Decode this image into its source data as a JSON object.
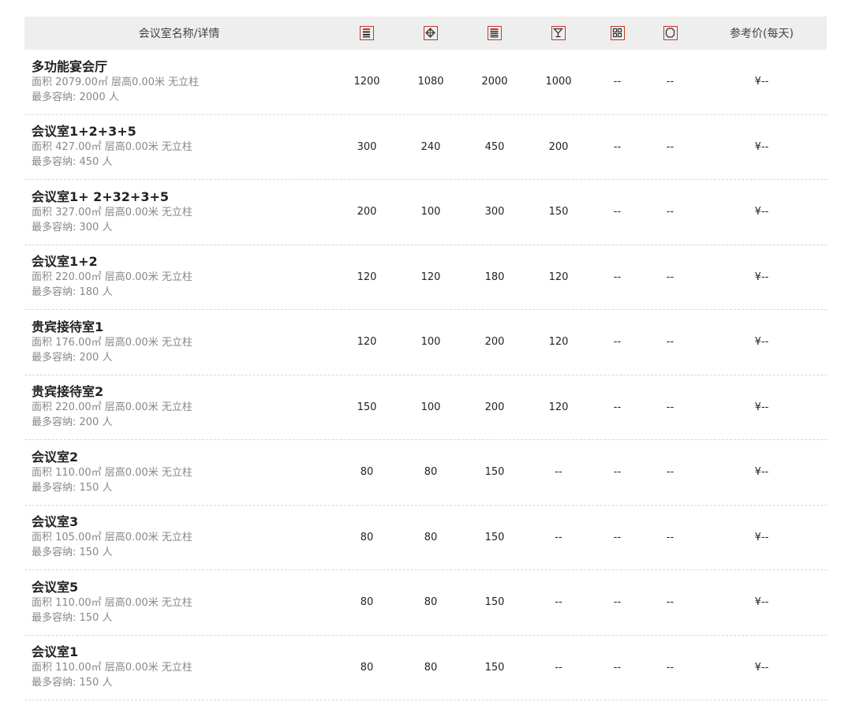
{
  "header": {
    "name_col": "会议室名称/详情",
    "icons": [
      "theater-layout-icon",
      "banquet-layout-icon",
      "classroom-layout-icon",
      "cocktail-layout-icon",
      "island-layout-icon",
      "boardroom-layout-icon"
    ],
    "price_col": "参考价(每天)"
  },
  "rooms": [
    {
      "name": "多功能宴会厅",
      "detail": "面积 2079.00㎡ 层高0.00米 无立柱",
      "capacity": "最多容纳: 2000 人",
      "vals": [
        "1200",
        "1080",
        "2000",
        "1000",
        "--",
        "--"
      ],
      "price": "¥--"
    },
    {
      "name": "会议室1+2+3+5",
      "detail": "面积 427.00㎡ 层高0.00米 无立柱",
      "capacity": "最多容纳: 450 人",
      "vals": [
        "300",
        "240",
        "450",
        "200",
        "--",
        "--"
      ],
      "price": "¥--"
    },
    {
      "name": "会议室1+ 2+32+3+5",
      "detail": "面积 327.00㎡ 层高0.00米 无立柱",
      "capacity": "最多容纳: 300 人",
      "vals": [
        "200",
        "100",
        "300",
        "150",
        "--",
        "--"
      ],
      "price": "¥--"
    },
    {
      "name": "会议室1+2",
      "detail": "面积 220.00㎡ 层高0.00米 无立柱",
      "capacity": "最多容纳: 180 人",
      "vals": [
        "120",
        "120",
        "180",
        "120",
        "--",
        "--"
      ],
      "price": "¥--"
    },
    {
      "name": "贵宾接待室1",
      "detail": "面积 176.00㎡ 层高0.00米 无立柱",
      "capacity": "最多容纳: 200 人",
      "vals": [
        "120",
        "100",
        "200",
        "120",
        "--",
        "--"
      ],
      "price": "¥--"
    },
    {
      "name": "贵宾接待室2",
      "detail": "面积 220.00㎡ 层高0.00米 无立柱",
      "capacity": "最多容纳: 200 人",
      "vals": [
        "150",
        "100",
        "200",
        "120",
        "--",
        "--"
      ],
      "price": "¥--"
    },
    {
      "name": "会议室2",
      "detail": "面积 110.00㎡ 层高0.00米 无立柱",
      "capacity": "最多容纳: 150 人",
      "vals": [
        "80",
        "80",
        "150",
        "--",
        "--",
        "--"
      ],
      "price": "¥--"
    },
    {
      "name": "会议室3",
      "detail": "面积 105.00㎡ 层高0.00米 无立柱",
      "capacity": "最多容纳: 150 人",
      "vals": [
        "80",
        "80",
        "150",
        "--",
        "--",
        "--"
      ],
      "price": "¥--"
    },
    {
      "name": "会议室5",
      "detail": "面积 110.00㎡ 层高0.00米 无立柱",
      "capacity": "最多容纳: 150 人",
      "vals": [
        "80",
        "80",
        "150",
        "--",
        "--",
        "--"
      ],
      "price": "¥--"
    },
    {
      "name": "会议室1",
      "detail": "面积 110.00㎡ 层高0.00米 无立柱",
      "capacity": "最多容纳: 150 人",
      "vals": [
        "80",
        "80",
        "150",
        "--",
        "--",
        "--"
      ],
      "price": "¥--"
    }
  ],
  "colors": {
    "icon_border": "#c0392b",
    "header_bg": "#eeeeee",
    "detail_text": "#888888"
  }
}
